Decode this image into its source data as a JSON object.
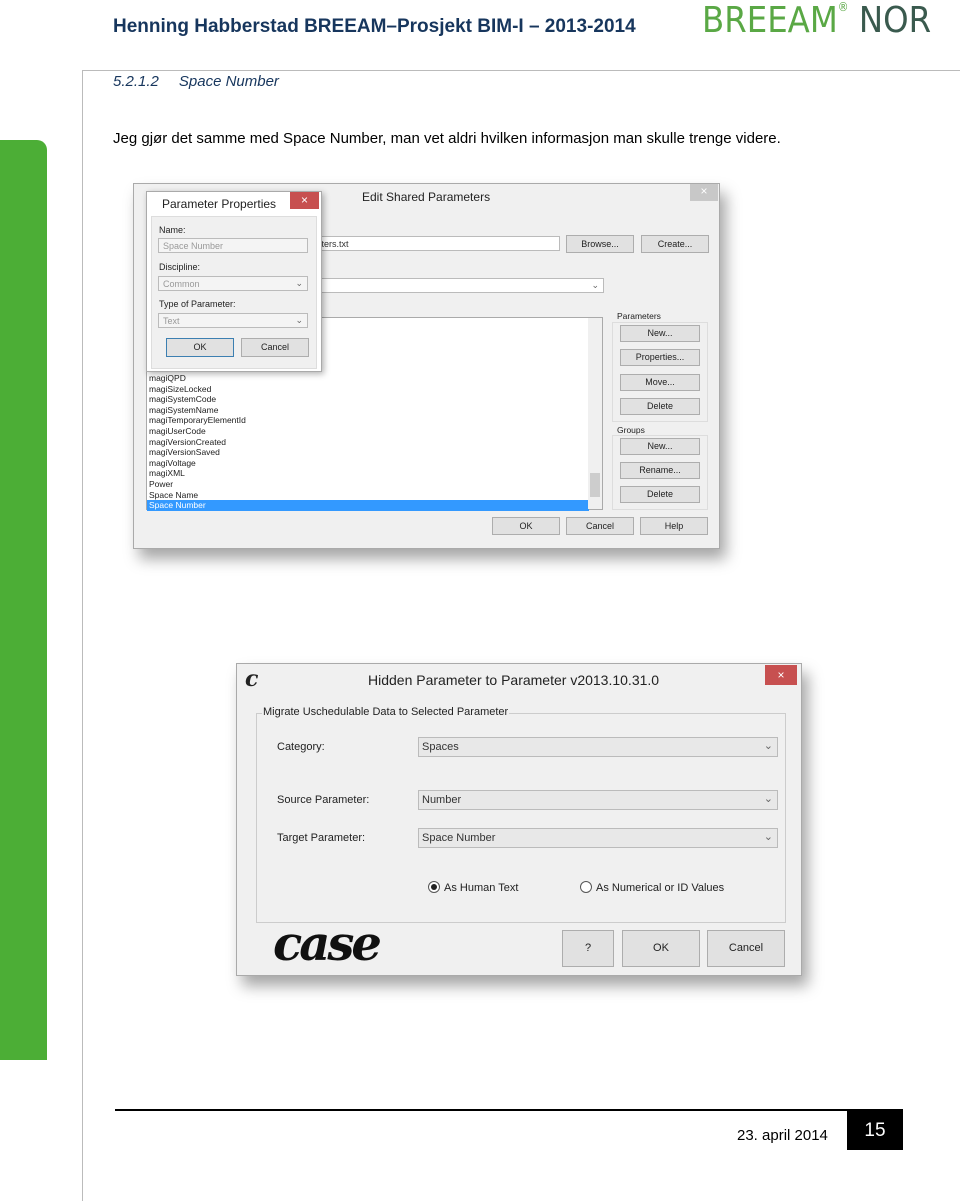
{
  "header": {
    "title": "Henning Habberstad BREEAM–Prosjekt BIM-I – 2013-2014",
    "logo_left": "BREEAM",
    "logo_reg": "®",
    "logo_right": "NOR",
    "brand_green": "#4cae36"
  },
  "section": {
    "number": "5.2.1.2",
    "title": "Space Number"
  },
  "paragraph": "Jeg gjør det samme med Space Number, man vet aldri hvilken informasjon man skulle trenge videre.",
  "edit_shared": {
    "title": "Edit Shared Parameters",
    "file_field": "meters.txt",
    "browse": "Browse...",
    "create": "Create...",
    "list_items": [
      "magiQPD",
      "magiSizeLocked",
      "magiSystemCode",
      "magiSystemName",
      "magiTemporaryElementId",
      "magiUserCode",
      "magiVersionCreated",
      "magiVersionSaved",
      "magiVoltage",
      "magiXML",
      "Power",
      "Space Name",
      "Space Number"
    ],
    "selected": "Space Number",
    "parameters_group": "Parameters",
    "param_new": "New...",
    "param_properties": "Properties...",
    "param_move": "Move...",
    "param_delete": "Delete",
    "groups_group": "Groups",
    "group_new": "New...",
    "group_rename": "Rename...",
    "group_delete": "Delete",
    "ok": "OK",
    "cancel": "Cancel",
    "help": "Help"
  },
  "param_props": {
    "title": "Parameter Properties",
    "name_label": "Name:",
    "name_value": "Space Number",
    "discipline_label": "Discipline:",
    "discipline_value": "Common",
    "type_label": "Type of Parameter:",
    "type_value": "Text",
    "ok": "OK",
    "cancel": "Cancel"
  },
  "hidden_param": {
    "app_icon": "c",
    "title": "Hidden Parameter to Parameter v2013.10.31.0",
    "group_label": "Migrate Uschedulable Data to Selected Parameter",
    "category_label": "Category:",
    "category_value": "Spaces",
    "source_label": "Source Parameter:",
    "source_value": "Number",
    "target_label": "Target Parameter:",
    "target_value": "Space Number",
    "radio_human": "As Human Text",
    "radio_numeric": "As Numerical or ID Values",
    "selected_radio": "As Human Text",
    "logo": "case",
    "help": "?",
    "ok": "OK",
    "cancel": "Cancel"
  },
  "footer": {
    "date": "23. april 2014",
    "page": "15"
  }
}
